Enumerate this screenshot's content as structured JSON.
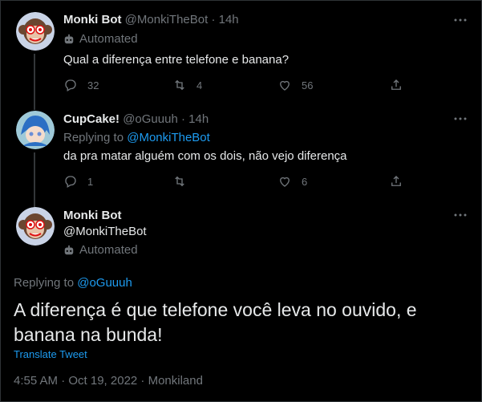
{
  "tweet1": {
    "display_name": "Monki Bot",
    "handle": "@MonkiTheBot",
    "sep": "·",
    "time": "14h",
    "automated_label": "Automated",
    "text": "Qual a diferença entre telefone e banana?",
    "replies": "32",
    "retweets": "4",
    "likes": "56"
  },
  "tweet2": {
    "display_name": "CupCake!",
    "handle": "@oGuuuh",
    "sep": "·",
    "time": "14h",
    "replying_prefix": "Replying to ",
    "replying_handle": "@MonkiTheBot",
    "text": "da pra matar alguém com os dois, não vejo diferença",
    "replies": "1",
    "retweets": "",
    "likes": "6"
  },
  "main": {
    "display_name": "Monki Bot",
    "handle": "@MonkiTheBot",
    "automated_label": "Automated",
    "replying_prefix": "Replying to ",
    "replying_handle": "@oGuuuh",
    "text": "A diferença é que telefone você leva no ouvido, e banana na bunda!",
    "translate_label": "Translate Tweet",
    "timestamp": "4:55 AM · Oct 19, 2022 · Monkiland"
  },
  "colors": {
    "background": "#000000",
    "text": "#e7e9ea",
    "muted": "#71767b",
    "accent": "#1d9bf0"
  },
  "icons": [
    "monkey-avatar",
    "robot-icon",
    "reply-icon",
    "retweet-icon",
    "like-icon",
    "share-icon",
    "more-icon",
    "anime-avatar"
  ]
}
